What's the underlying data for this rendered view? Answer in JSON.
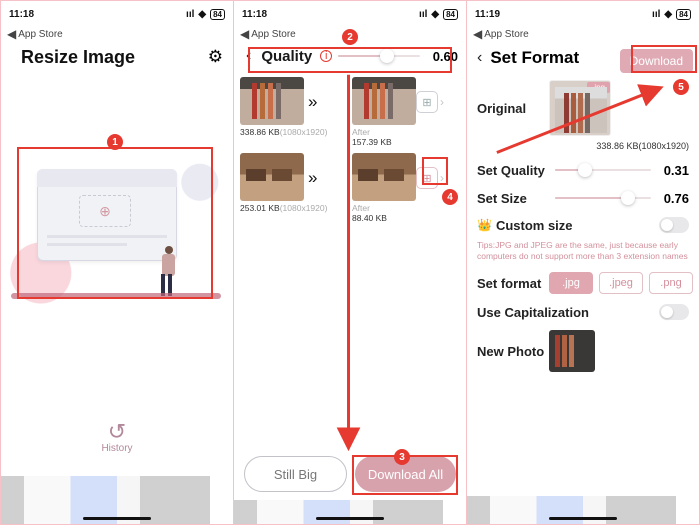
{
  "screen1": {
    "time": "11:18",
    "back": "App Store",
    "battery": "84",
    "title": "Resize Image",
    "history_label": "History",
    "marker1": "1"
  },
  "screen2": {
    "time": "11:18",
    "back": "App Store",
    "battery": "84",
    "marker2": "2",
    "marker3": "3",
    "marker4": "4",
    "quality_label": "Quality",
    "quality_value": "0.60",
    "items": [
      {
        "orig": "338.86 KB",
        "origdim": "(1080x1920)",
        "after_label": "After",
        "after": "157.39 KB"
      },
      {
        "orig": "253.01 KB",
        "origdim": "(1080x1920)",
        "after_label": "After",
        "after": "88.40 KB"
      }
    ],
    "still_big": "Still Big",
    "download_all": "Download All"
  },
  "screen3": {
    "time": "11:19",
    "back": "App Store",
    "battery": "84",
    "marker5": "5",
    "title": "Set Format",
    "download": "Download",
    "original": "Original",
    "jpg_tag": ".jpg",
    "orig_size": "338.86 KB(1080x1920)",
    "set_quality": "Set Quality",
    "q_val": "0.31",
    "set_size": "Set Size",
    "s_val": "0.76",
    "custom_size": "Custom size",
    "tips": "Tips:JPG and JPEG are the same, just because early computers do not support more than 3 extension names",
    "set_format": "Set format",
    "fmt": {
      "jpg": ".jpg",
      "jpeg": ".jpeg",
      "png": ".png"
    },
    "use_cap": "Use Capitalization",
    "new_photo": "New Photo"
  }
}
